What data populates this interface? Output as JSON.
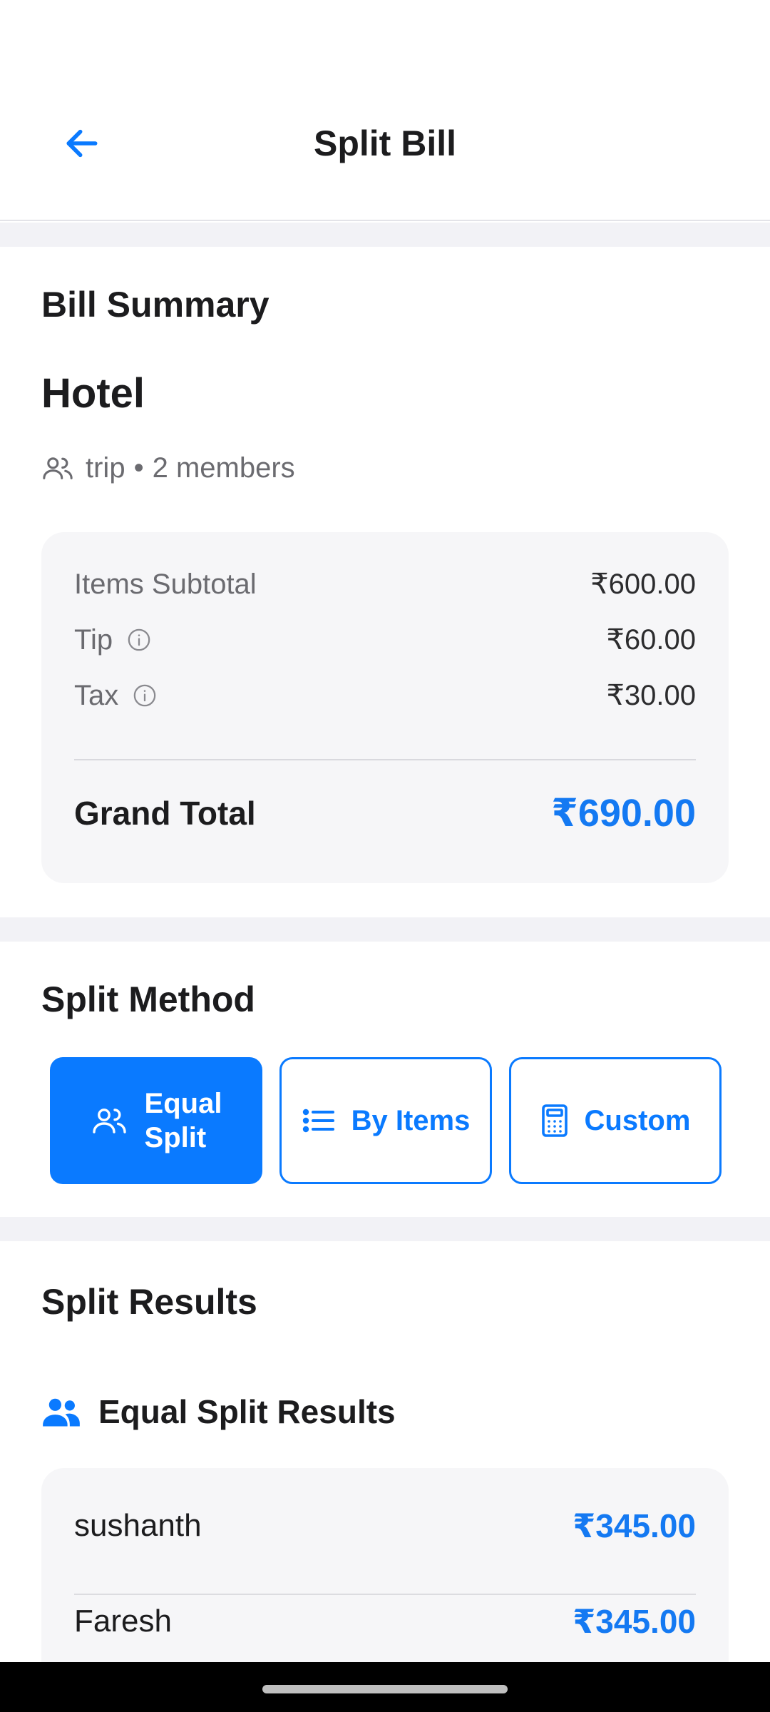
{
  "header": {
    "title": "Split Bill",
    "back_icon": "arrow-left-icon"
  },
  "bill_summary": {
    "section_title": "Bill Summary",
    "bill_name": "Hotel",
    "group": "trip",
    "separator": "•",
    "members": "2 members",
    "rows": [
      {
        "label": "Items Subtotal",
        "amount": "₹600.00"
      },
      {
        "label": "Tip",
        "amount": "₹60.00"
      },
      {
        "label": "Tax",
        "amount": "₹30.00"
      }
    ],
    "grand_total_label": "Grand Total",
    "grand_total_amount": "₹690.00"
  },
  "split_method": {
    "section_title": "Split Method",
    "options": [
      {
        "line1": "Equal",
        "line2": "Split",
        "icon": "people-icon",
        "selected": true
      },
      {
        "label": "By Items",
        "icon": "list-icon",
        "selected": false
      },
      {
        "label": "Custom",
        "icon": "calculator-icon",
        "selected": false
      }
    ]
  },
  "split_results": {
    "section_title": "Split Results",
    "subtitle": "Equal Split Results",
    "people": [
      {
        "name": "sushanth",
        "amount": "₹345.00"
      },
      {
        "name": "Faresh",
        "amount": "₹345.00"
      }
    ]
  },
  "colors": {
    "accent": "#0a7aff",
    "amount_blue": "#1479f2",
    "band": "#f2f2f6",
    "card": "#f6f6f8"
  }
}
